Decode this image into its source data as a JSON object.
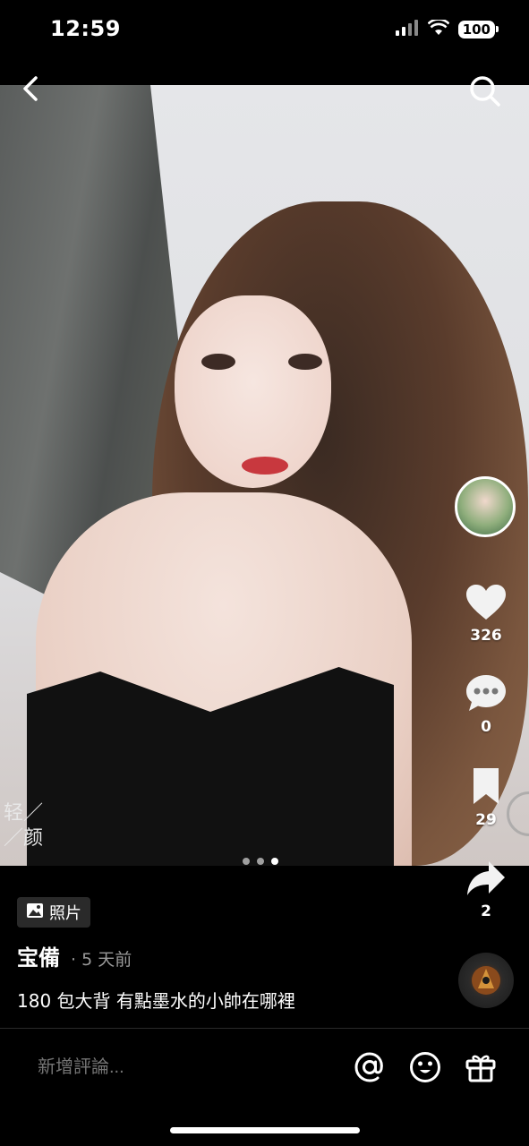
{
  "status_bar": {
    "time": "12:59",
    "battery": "100"
  },
  "post": {
    "media_type_label": "照片",
    "author": "宝備",
    "time_ago": "· 5 天前",
    "caption": "180 包大背 有點墨水的小帥在哪裡",
    "watermark": "轻／\n／颜",
    "image_count": 3,
    "active_image_index": 2
  },
  "actions": {
    "likes": "326",
    "comments": "0",
    "saves": "29",
    "shares": "2"
  },
  "comment_bar": {
    "placeholder": "新增評論..."
  },
  "icons": [
    "back-icon",
    "search-icon",
    "heart-icon",
    "comment-icon",
    "bookmark-icon",
    "share-icon",
    "photo-icon",
    "at-icon",
    "emoji-icon",
    "gift-icon"
  ]
}
